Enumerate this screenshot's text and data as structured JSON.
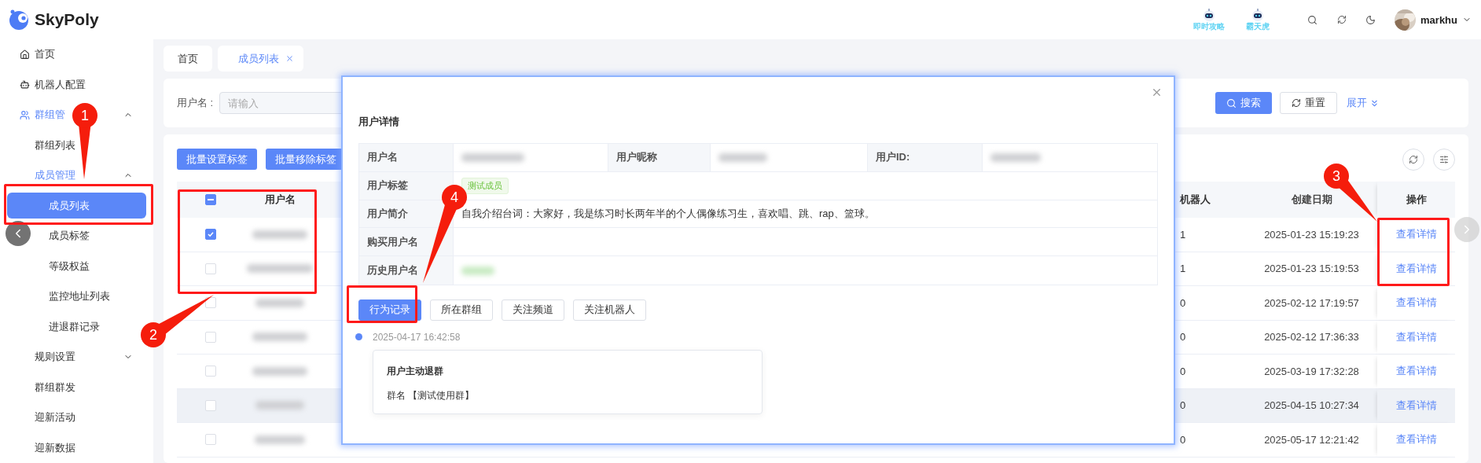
{
  "app": {
    "logo": "SkyPoly"
  },
  "header": {
    "shortcuts": [
      {
        "label": "即时攻略"
      },
      {
        "label": "霸天虎"
      }
    ],
    "user": {
      "name": "markhu"
    }
  },
  "sidebar": {
    "items": [
      {
        "label": "首页",
        "selected": false
      },
      {
        "label": "机器人配置",
        "selected": false
      },
      {
        "label": "群组管",
        "expanded": true,
        "children": [
          {
            "label": "群组列表",
            "selected": false
          },
          {
            "label": "成员管理",
            "expanded": true,
            "children": [
              {
                "label": "成员列表",
                "selected": true
              },
              {
                "label": "成员标签",
                "selected": false
              },
              {
                "label": "等级权益",
                "selected": false
              },
              {
                "label": "监控地址列表",
                "selected": false
              },
              {
                "label": "进退群记录",
                "selected": false
              }
            ]
          }
        ]
      },
      {
        "label": "规则设置",
        "expanded": false
      },
      {
        "label": "群组群发",
        "selected": false
      },
      {
        "label": "迎新活动",
        "selected": false
      },
      {
        "label": "迎新数据",
        "selected": false
      }
    ]
  },
  "tabs": [
    {
      "label": "首页",
      "selected": false,
      "closable": false
    },
    {
      "label": "成员列表",
      "selected": true,
      "closable": true
    }
  ],
  "search": {
    "label": "用户名 :",
    "placeholder": "请输入",
    "search_button": "搜索",
    "reset_button": "重置",
    "expand_link": "展开"
  },
  "toolbar": {
    "buttons": [
      "批量设置标签",
      "批量移除标签"
    ]
  },
  "table": {
    "select_all": {
      "indeterminate": true
    },
    "columns": [
      "用户名",
      "机器人",
      "创建日期",
      "操作"
    ],
    "rows": [
      {
        "checked": true,
        "highlighted": false,
        "column_3": "1",
        "created": "2025-01-23 15:19:23",
        "action": "查看详情"
      },
      {
        "checked": false,
        "highlighted": false,
        "column_3": "1",
        "created": "2025-01-23 15:19:53",
        "action": "查看详情"
      },
      {
        "checked": false,
        "highlighted": false,
        "column_3": "0",
        "created": "2025-02-12 17:19:57",
        "action": "查看详情"
      },
      {
        "checked": false,
        "highlighted": false,
        "column_3": "0",
        "created": "2025-02-12 17:36:33",
        "action": "查看详情"
      },
      {
        "checked": false,
        "highlighted": false,
        "column_3": "0",
        "created": "2025-03-19 17:32:28",
        "action": "查看详情"
      },
      {
        "checked": false,
        "highlighted": true,
        "column_3": "0",
        "created": "2025-04-15 10:27:34",
        "action": "查看详情"
      },
      {
        "checked": false,
        "highlighted": false,
        "column_3": "0",
        "created": "2025-05-17 12:21:42",
        "action": "查看详情"
      }
    ]
  },
  "dialog": {
    "title": "用户详情",
    "details": [
      {
        "items": [
          {
            "label": "用户名",
            "kind": "redacted"
          },
          {
            "label": "用户昵称",
            "kind": "redacted"
          },
          {
            "label": "用户ID:",
            "kind": "redacted"
          }
        ]
      },
      {
        "items": [
          {
            "label": "用户标签",
            "kind": "tag",
            "value": "测试成员"
          }
        ]
      },
      {
        "items": [
          {
            "label": "用户简介",
            "kind": "text",
            "value": "自我介绍台词：大家好，我是练习时长两年半的个人偶像练习生，喜欢唱、跳、rap、篮球。"
          }
        ]
      },
      {
        "items": [
          {
            "label": "购买用户名",
            "kind": "empty"
          }
        ]
      },
      {
        "items": [
          {
            "label": "历史用户名",
            "kind": "redacted_tag"
          }
        ]
      }
    ],
    "tabs": [
      {
        "label": "行为记录",
        "selected": true
      },
      {
        "label": "所在群组",
        "selected": false
      },
      {
        "label": "关注频道",
        "selected": false
      },
      {
        "label": "关注机器人",
        "selected": false
      }
    ],
    "timeline": [
      {
        "time": "2025-04-17 16:42:58",
        "title": "用户主动退群",
        "detail": "群名 【测试使用群】"
      }
    ]
  },
  "annotations": [
    {
      "number": "1"
    },
    {
      "number": "2"
    },
    {
      "number": "3"
    },
    {
      "number": "4"
    }
  ]
}
